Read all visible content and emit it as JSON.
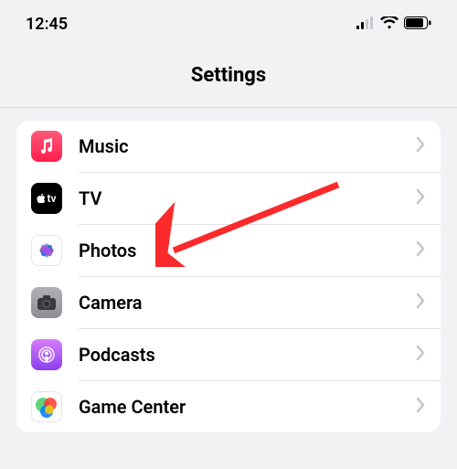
{
  "status": {
    "time": "12:45"
  },
  "header": {
    "title": "Settings"
  },
  "icons": {
    "music": "music-icon",
    "tv": "tv-icon",
    "photos": "photos-icon",
    "camera": "camera-icon",
    "podcasts": "podcasts-icon",
    "gamecenter": "gamecenter-icon"
  },
  "colors": {
    "music_bg": "#ff2d55",
    "tv_bg": "#000000",
    "photos_bg": "#ffffff",
    "camera_bg": "#8e8e93",
    "podcasts_bg": "#9f4cf3",
    "gamecenter_bg": "#ffffff",
    "arrow": "#fc2a2a"
  },
  "rows": [
    {
      "label": "Music"
    },
    {
      "label": "TV"
    },
    {
      "label": "Photos"
    },
    {
      "label": "Camera"
    },
    {
      "label": "Podcasts"
    },
    {
      "label": "Game Center"
    }
  ]
}
